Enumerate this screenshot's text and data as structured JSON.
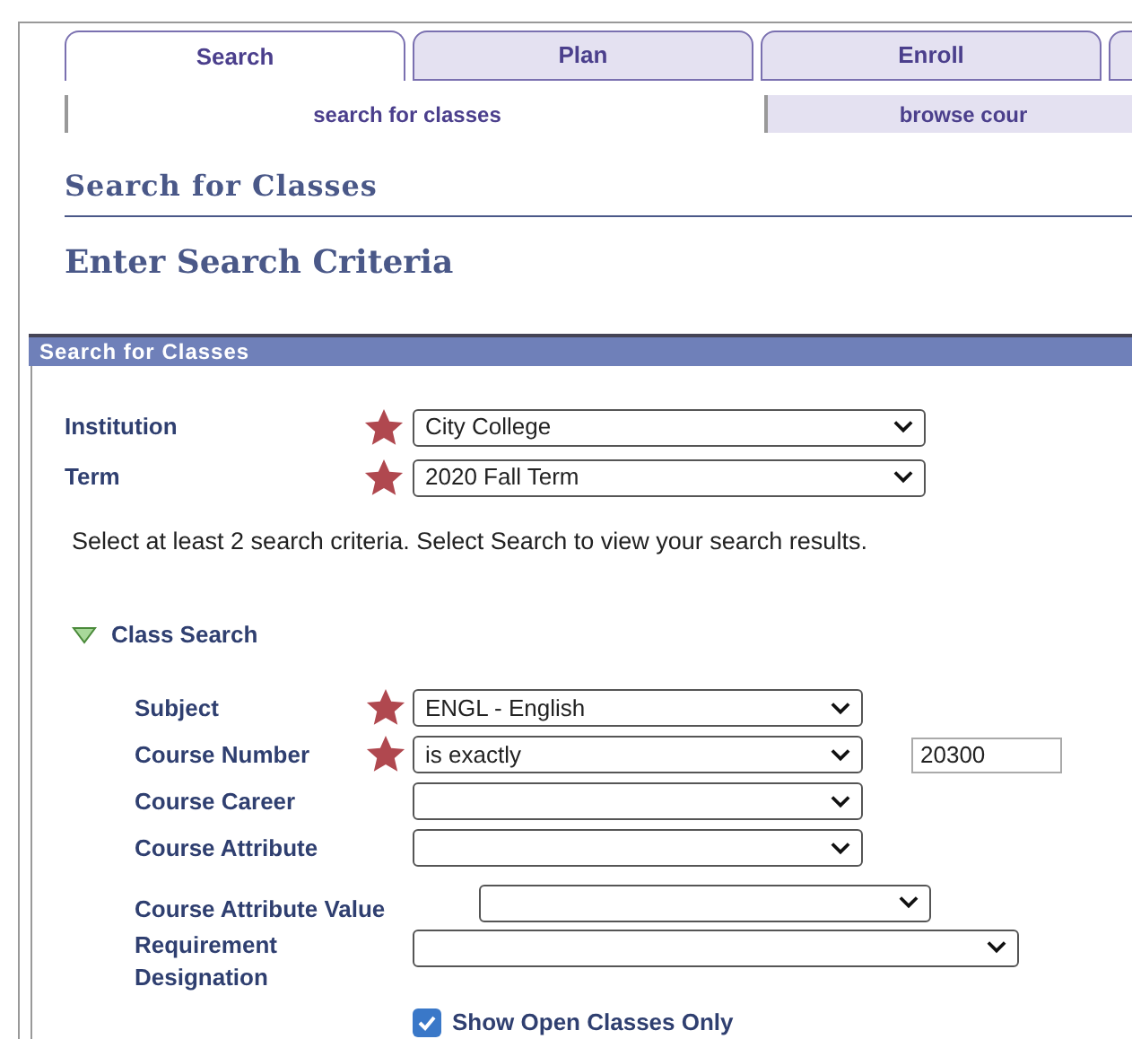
{
  "tabs": [
    {
      "label": "Search",
      "selected": true
    },
    {
      "label": "Plan",
      "selected": false
    },
    {
      "label": "Enroll",
      "selected": false
    },
    {
      "selected": false
    }
  ],
  "subtabs": [
    {
      "label": "search for classes",
      "selected": true
    },
    {
      "label": "browse cour",
      "selected": false
    }
  ],
  "page_title": "Search for Classes",
  "subtitle": "Enter Search Criteria",
  "section": {
    "title": "Search for Classes"
  },
  "top_fields": [
    {
      "label": "Institution",
      "starred": true,
      "value": "City College"
    },
    {
      "label": "Term",
      "starred": true,
      "value": "2020 Fall Term"
    }
  ],
  "instructions": "Select at least 2 search criteria. Select Search to view your search results.",
  "class_search": {
    "title": "Class Search",
    "expanded": true,
    "fields": [
      {
        "label": "Subject",
        "starred": true,
        "value": "ENGL - English"
      },
      {
        "label": "Course Number",
        "starred": true,
        "value": "is exactly",
        "extra_value": "20300"
      },
      {
        "label": "Course Career",
        "starred": false
      },
      {
        "label": "Course Attribute",
        "starred": false
      },
      {
        "label": "Course Attribute Value",
        "starred": false
      },
      {
        "label": "Requirement Designation",
        "starred": false
      }
    ],
    "show_open_only": {
      "label": "Show Open Classes Only",
      "checked": true
    }
  }
}
